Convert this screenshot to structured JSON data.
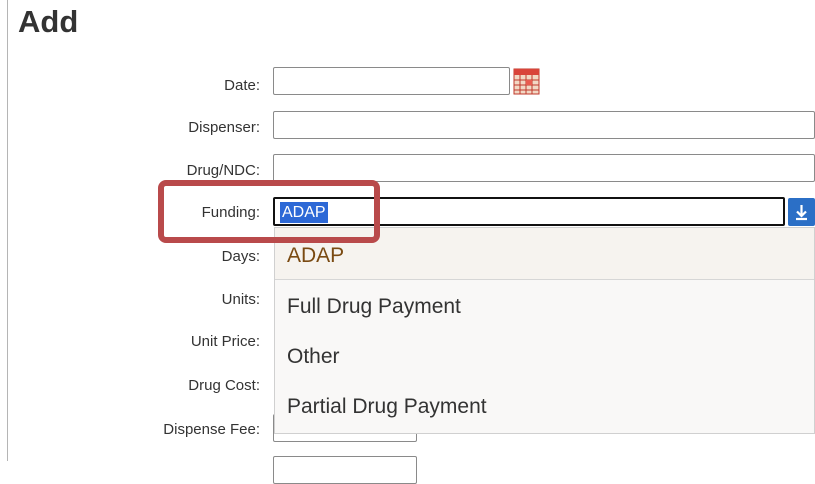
{
  "form": {
    "title": "Add",
    "labels": {
      "date": "Date:",
      "dispenser": "Dispenser:",
      "drug_ndc": "Drug/NDC:",
      "funding": "Funding:",
      "days": "Days:",
      "units": "Units:",
      "unit_price": "Unit Price:",
      "drug_cost": "Drug Cost:",
      "dispense_fee": "Dispense Fee:"
    },
    "funding_value": "ADAP"
  },
  "dropdown": {
    "options": [
      "ADAP",
      "Full Drug Payment",
      "Other",
      "Partial Drug Payment"
    ]
  },
  "icons": {
    "date_picker": "calendar-icon",
    "funding_toggle": "download-arrow-icon"
  },
  "colors": {
    "selection": "#2c68d6",
    "callout": "#b94a4b",
    "dropdown_button": "#2b6fc6"
  }
}
